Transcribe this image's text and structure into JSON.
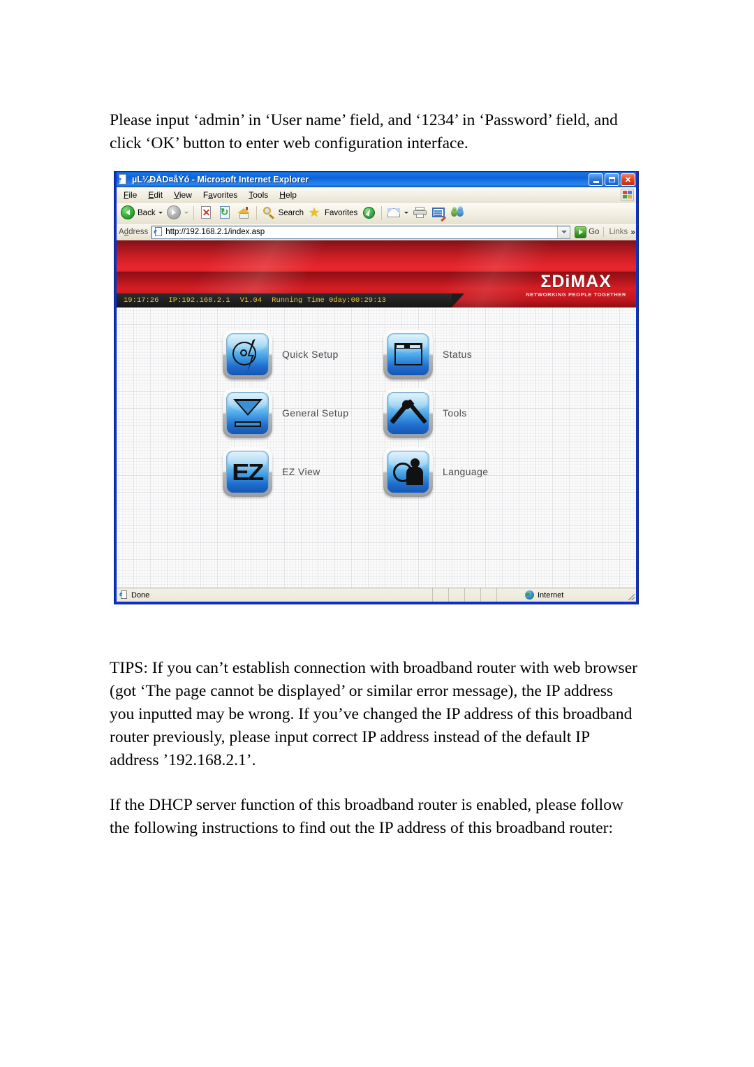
{
  "document": {
    "paragraphs": {
      "intro": "Please input ‘admin’ in ‘User name’ field, and ‘1234’ in ‘Password’ field, and click ‘OK’ button to enter web configuration interface.",
      "tips": "TIPS: If you can’t establish connection with broadband router with web browser (got ‘The page cannot be displayed’ or similar error message), the IP address you inputted may be wrong. If you’ve changed the IP address of this broadband router previously, please input correct IP address instead of the default IP address ’192.168.2.1’.",
      "dhcp": "If the DHCP server function of this broadband router is enabled, please follow the following instructions to find out the IP address of this broadband router:"
    }
  },
  "browser": {
    "title": "µL¼ÐÃD¤åÝó - Microsoft Internet Explorer",
    "window_controls": {
      "minimize": "_",
      "maximize": "□",
      "close": "✕"
    },
    "menu": [
      {
        "label": "File",
        "accel": "F",
        "rest": "ile"
      },
      {
        "label": "Edit",
        "accel": "E",
        "rest": "dit"
      },
      {
        "label": "View",
        "accel": "V",
        "rest": "iew"
      },
      {
        "label": "Favorites",
        "accel": "a",
        "pre": "F",
        "rest": "vorites"
      },
      {
        "label": "Tools",
        "accel": "T",
        "rest": "ools"
      },
      {
        "label": "Help",
        "accel": "H",
        "rest": "elp"
      }
    ],
    "toolbar": {
      "back_label": "Back",
      "search_label": "Search",
      "favorites_label": "Favorites",
      "icons": [
        "back-icon",
        "forward-icon",
        "stop-icon",
        "refresh-icon",
        "home-icon",
        "search-icon",
        "favorites-star-icon",
        "media-icon",
        "mail-icon",
        "print-icon",
        "edit-icon",
        "messenger-icon"
      ]
    },
    "address": {
      "label": "Address",
      "label_accel": "d",
      "label_pre": "A",
      "label_rest": "dress",
      "value": "http://192.168.2.1/index.asp",
      "placeholder": "",
      "go_label": "Go",
      "links_label": "Links",
      "links_chevron": "»"
    },
    "status_bar": {
      "text": "Done",
      "zone": "Internet"
    }
  },
  "router_ui": {
    "banner": {
      "logo_text": "ΣDiMAX",
      "logo_tagline": "NETWORKING PEOPLE TOGETHER",
      "logo_color": "#ffffff",
      "banner_color": "#d71d24"
    },
    "status_strip": {
      "time": "19:17:26",
      "ip": "IP:192.168.2.1",
      "version": "V1.04",
      "running_time": "Running Time 0day:00:29:13",
      "text_color": "#e8c23c",
      "background_color": "#1d1d1d"
    },
    "menu_items": [
      {
        "label": "Quick Setup",
        "icon": "quick-setup-icon"
      },
      {
        "label": "Status",
        "icon": "status-icon"
      },
      {
        "label": "General Setup",
        "icon": "general-setup-icon"
      },
      {
        "label": "Tools",
        "icon": "tools-icon"
      },
      {
        "label": "EZ View",
        "icon": "ez-view-icon"
      },
      {
        "label": "Language",
        "icon": "language-icon"
      }
    ],
    "ez_glyph": "EZ"
  }
}
